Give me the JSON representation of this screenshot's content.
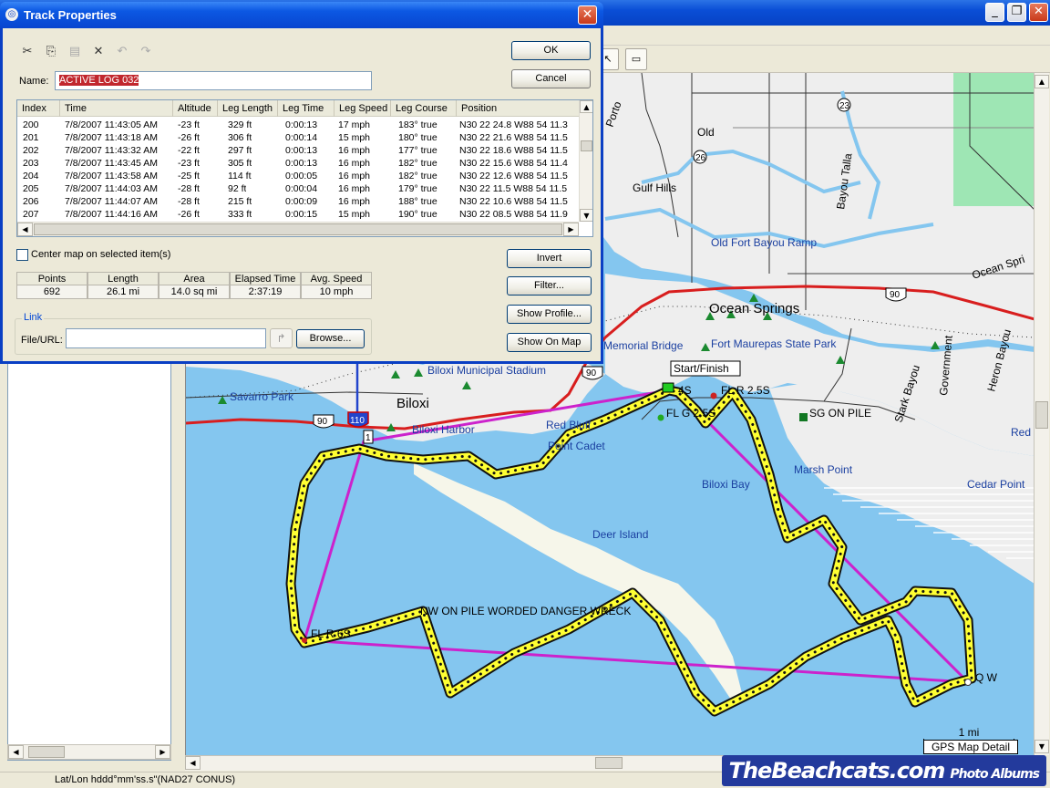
{
  "dialog": {
    "title": "Track Properties",
    "close_glyph": "✕",
    "ok_label": "OK",
    "cancel_label": "Cancel",
    "name_label": "Name:",
    "name_value": "ACTIVE LOG 032",
    "toolbar": {
      "cut": "✂",
      "copy": "⎘",
      "paste": "📋",
      "delete": "✕",
      "undo": "↶",
      "redo": "↷"
    },
    "table": {
      "columns": [
        "Index",
        "Time",
        "Altitude",
        "Leg Length",
        "Leg Time",
        "Leg Speed",
        "Leg Course",
        "Position"
      ],
      "rows": [
        [
          "200",
          "7/8/2007 11:43:05 AM",
          "-23 ft",
          "329 ft",
          "0:00:13",
          "17 mph",
          "183° true",
          "N30 22 24.8 W88 54 11.3"
        ],
        [
          "201",
          "7/8/2007 11:43:18 AM",
          "-26 ft",
          "306 ft",
          "0:00:14",
          "15 mph",
          "180° true",
          "N30 22 21.6 W88 54 11.5"
        ],
        [
          "202",
          "7/8/2007 11:43:32 AM",
          "-22 ft",
          "297 ft",
          "0:00:13",
          "16 mph",
          "177° true",
          "N30 22 18.6 W88 54 11.5"
        ],
        [
          "203",
          "7/8/2007 11:43:45 AM",
          "-23 ft",
          "305 ft",
          "0:00:13",
          "16 mph",
          "182° true",
          "N30 22 15.6 W88 54 11.4"
        ],
        [
          "204",
          "7/8/2007 11:43:58 AM",
          "-25 ft",
          "114 ft",
          "0:00:05",
          "16 mph",
          "182° true",
          "N30 22 12.6 W88 54 11.5"
        ],
        [
          "205",
          "7/8/2007 11:44:03 AM",
          "-28 ft",
          "92 ft",
          "0:00:04",
          "16 mph",
          "179° true",
          "N30 22 11.5 W88 54 11.5"
        ],
        [
          "206",
          "7/8/2007 11:44:07 AM",
          "-28 ft",
          "215 ft",
          "0:00:09",
          "16 mph",
          "188° true",
          "N30 22 10.6 W88 54 11.5"
        ],
        [
          "207",
          "7/8/2007 11:44:16 AM",
          "-26 ft",
          "333 ft",
          "0:00:15",
          "15 mph",
          "190° true",
          "N30 22 08.5 W88 54 11.9"
        ]
      ]
    },
    "center_label": "Center map on selected item(s)",
    "invert_label": "Invert",
    "filter_label": "Filter...",
    "show_profile_label": "Show Profile...",
    "show_on_map_label": "Show On Map",
    "stats": {
      "headers": [
        "Points",
        "Length",
        "Area",
        "Elapsed Time",
        "Avg. Speed"
      ],
      "values": [
        "692",
        "26.1 mi",
        "14.0 sq mi",
        "2:37:19",
        "10 mph"
      ]
    },
    "link_legend": "Link",
    "file_url_label": "File/URL:",
    "file_url_value": "",
    "browse_label": "Browse..."
  },
  "main": {
    "window_buttons": {
      "minimize": "_",
      "maximize": "❐",
      "close": "✕"
    },
    "status_text": "Lat/Lon hddd°mm'ss.s\"(NAD27 CONUS)",
    "watermark": "TheBeachcats.com",
    "watermark_small": "Photo Albums"
  },
  "map": {
    "scale_value": "1 mi",
    "scale_caption": "GPS Map Detail",
    "labels": {
      "old": "Old",
      "gulf_hills": "Gulf Hills",
      "bayou_talla": "Bayou Talla",
      "old_fort_bayou_ramp": "Old Fort Bayou Ramp",
      "ocean_springs": "Ocean Springs",
      "ocean_spr": "Ocean Spri",
      "memorial_bridge": "Memorial Bridge",
      "fort_maurepas": "Fort Maurepas State Park",
      "biloxi_municipal": "Biloxi Municipal Stadium",
      "savarro_park": "Savarro Park",
      "biloxi": "Biloxi",
      "biloxi_harbor": "Biloxi Harbor",
      "red_bluff": "Red Bluff",
      "point_cadet": "Point Cadet",
      "start_finish": "Start/Finish",
      "fl_g_4s": "4S",
      "fl_r_25s": "FL R 2.5S",
      "fl_g_25s": "FL G 2.5S",
      "sg_on_pile": "SG ON PILE",
      "stark_bayou": "Stark Bayou",
      "government": "Government",
      "heron_bayou": "Heron Bayou",
      "red_i": "Red I",
      "marsh_point": "Marsh Point",
      "cedar_point": "Cedar Point",
      "biloxi_bay": "Biloxi Bay",
      "deer_island": "Deer Island",
      "danger_wreck": "NW ON PILE WORDED DANGER WRECK",
      "fl_r_6s": "FL R 6S",
      "q_w": "Q W",
      "road_23": "23",
      "road_26": "26",
      "us_90_a": "90",
      "us_90_b": "90",
      "us_90_c": "90",
      "i_110": "110",
      "marker_1": "1",
      "porto": "Porto"
    },
    "colors": {
      "water": "#84c6ef",
      "land": "#eeeeee",
      "park": "#9ee6b4",
      "highway": "#d81e1e",
      "track_fill": "#ffff33",
      "track_dots": "#111111",
      "route": "#cc22cc"
    }
  }
}
